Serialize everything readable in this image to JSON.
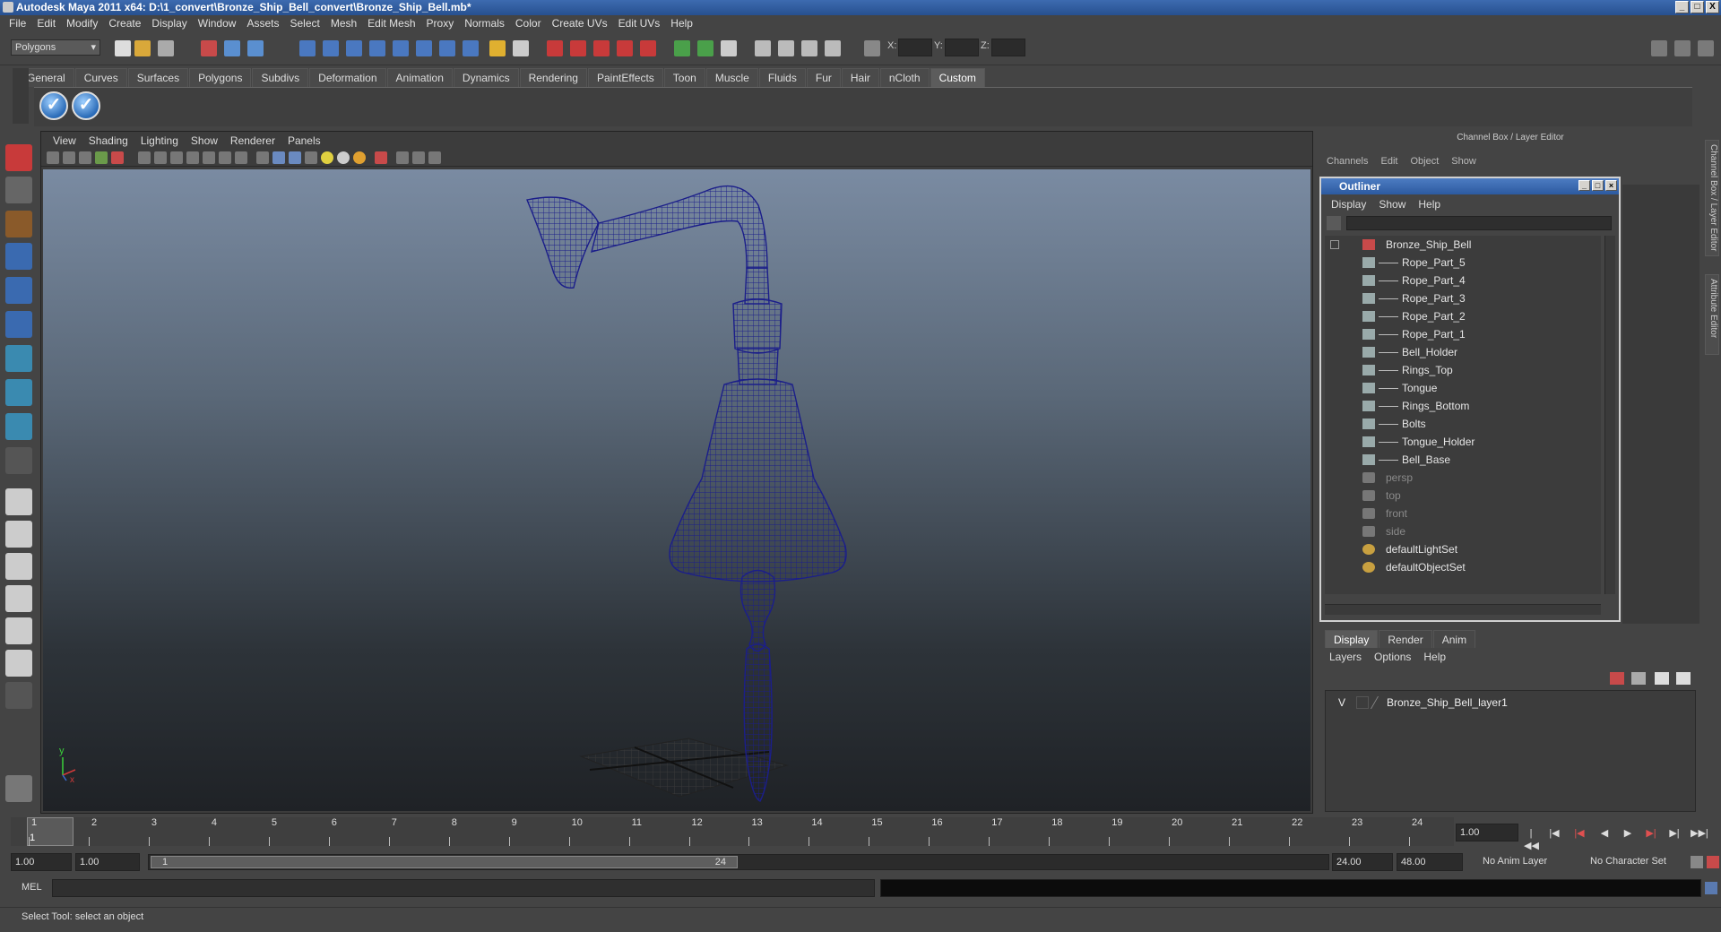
{
  "window": {
    "title": "Autodesk Maya 2011 x64: D:\\1_convert\\Bronze_Ship_Bell_convert\\Bronze_Ship_Bell.mb*",
    "controls": [
      "_",
      "□",
      "X"
    ]
  },
  "menubar": [
    "File",
    "Edit",
    "Modify",
    "Create",
    "Display",
    "Window",
    "Assets",
    "Select",
    "Mesh",
    "Edit Mesh",
    "Proxy",
    "Normals",
    "Color",
    "Create UVs",
    "Edit UVs",
    "Help"
  ],
  "statusline": {
    "mode": "Polygons",
    "x_label": "X:",
    "y_label": "Y:",
    "z_label": "Z:"
  },
  "shelf": {
    "tabs": [
      "General",
      "Curves",
      "Surfaces",
      "Polygons",
      "Subdivs",
      "Deformation",
      "Animation",
      "Dynamics",
      "Rendering",
      "PaintEffects",
      "Toon",
      "Muscle",
      "Fluids",
      "Fur",
      "Hair",
      "nCloth",
      "Custom"
    ],
    "active_tab": "Custom",
    "buttons": [
      "check-icon",
      "check-icon"
    ]
  },
  "viewport": {
    "menu": [
      "View",
      "Shading",
      "Lighting",
      "Show",
      "Renderer",
      "Panels"
    ],
    "axis_y": "y",
    "axis_x": "x",
    "wire_color": "#1b1e8a"
  },
  "channelbox": {
    "title": "Channel Box / Layer Editor",
    "menu": [
      "Channels",
      "Edit",
      "Object",
      "Show"
    ]
  },
  "outliner": {
    "title": "Outliner",
    "menu": [
      "Display",
      "Show",
      "Help"
    ],
    "root": "Bronze_Ship_Bell",
    "children": [
      "Rope_Part_5",
      "Rope_Part_4",
      "Rope_Part_3",
      "Rope_Part_2",
      "Rope_Part_1",
      "Bell_Holder",
      "Rings_Top",
      "Tongue",
      "Rings_Bottom",
      "Bolts",
      "Tongue_Holder",
      "Bell_Base"
    ],
    "cameras": [
      "persp",
      "top",
      "front",
      "side"
    ],
    "sets": [
      "defaultLightSet",
      "defaultObjectSet"
    ]
  },
  "layer_editor": {
    "tabs": [
      "Display",
      "Render",
      "Anim"
    ],
    "active_tab": "Display",
    "menu": [
      "Layers",
      "Options",
      "Help"
    ],
    "layers": [
      {
        "visible": "V",
        "name": "Bronze_Ship_Bell_layer1"
      }
    ]
  },
  "side_tabs": [
    "Channel Box / Layer Editor",
    "Attribute Editor"
  ],
  "timeline": {
    "start": 1,
    "end": 24,
    "current_frame": "1",
    "current_field": "1.00",
    "playback_buttons": [
      "|◀◀",
      "|◀",
      "◀|",
      "◀",
      "▶",
      "▶|",
      "▶▶|",
      "▶▶|"
    ]
  },
  "range": {
    "start_time": "1.00",
    "playback_start": "1.00",
    "thumb_start": "1",
    "thumb_end": "24",
    "playback_end": "24.00",
    "end_time": "48.00",
    "anim_layer": "No Anim Layer",
    "character_set": "No Character Set"
  },
  "cmdline": {
    "label": "MEL"
  },
  "helpline": {
    "text": "Select Tool: select an object"
  }
}
